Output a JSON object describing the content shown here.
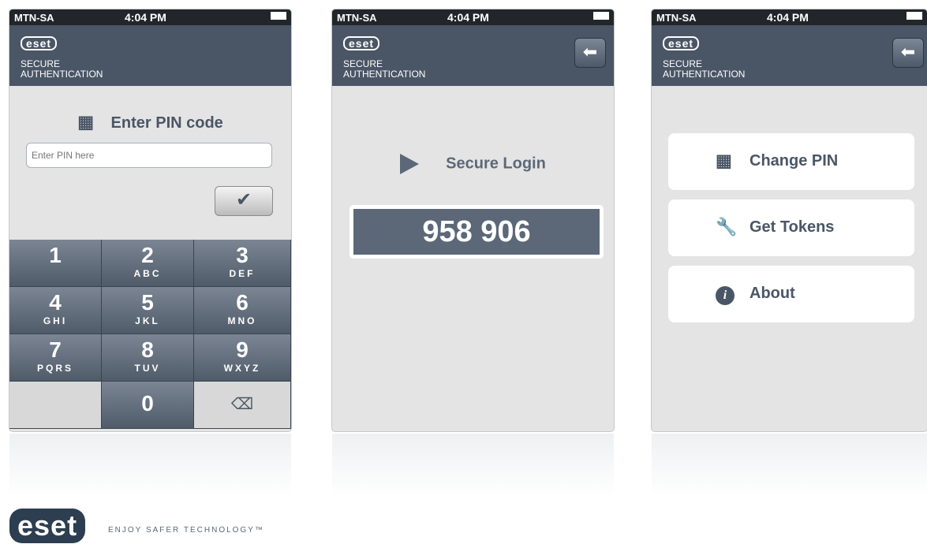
{
  "status": {
    "carrier": "MTN-SA",
    "time": "4:04 PM"
  },
  "app": {
    "logo": "eset",
    "subtitle_line1": "SECURE",
    "subtitle_line2": "AUTHENTICATION"
  },
  "pin_screen": {
    "title": "Enter PIN code",
    "input_placeholder": "Enter PIN here",
    "keys": [
      {
        "num": "1",
        "letters": ""
      },
      {
        "num": "2",
        "letters": "ABC"
      },
      {
        "num": "3",
        "letters": "DEF"
      },
      {
        "num": "4",
        "letters": "GHI"
      },
      {
        "num": "5",
        "letters": "JKL"
      },
      {
        "num": "6",
        "letters": "MNO"
      },
      {
        "num": "7",
        "letters": "PQRS"
      },
      {
        "num": "8",
        "letters": "TUV"
      },
      {
        "num": "9",
        "letters": "WXYZ"
      },
      {
        "num": "0",
        "letters": ""
      }
    ]
  },
  "login_screen": {
    "title": "Secure Login",
    "otp": "958 906"
  },
  "menu_screen": {
    "items": [
      {
        "label": "Change PIN"
      },
      {
        "label": "Get Tokens"
      },
      {
        "label": "About"
      }
    ]
  },
  "footer": {
    "logo": "eset",
    "tagline": "ENJOY SAFER TECHNOLOGY™"
  },
  "icons": [
    "keypad-icon",
    "checkmark-icon",
    "backspace-icon",
    "back-arrow-icon",
    "play-icon",
    "wrench-icon",
    "info-icon",
    "wifi-icon",
    "battery-icon"
  ]
}
